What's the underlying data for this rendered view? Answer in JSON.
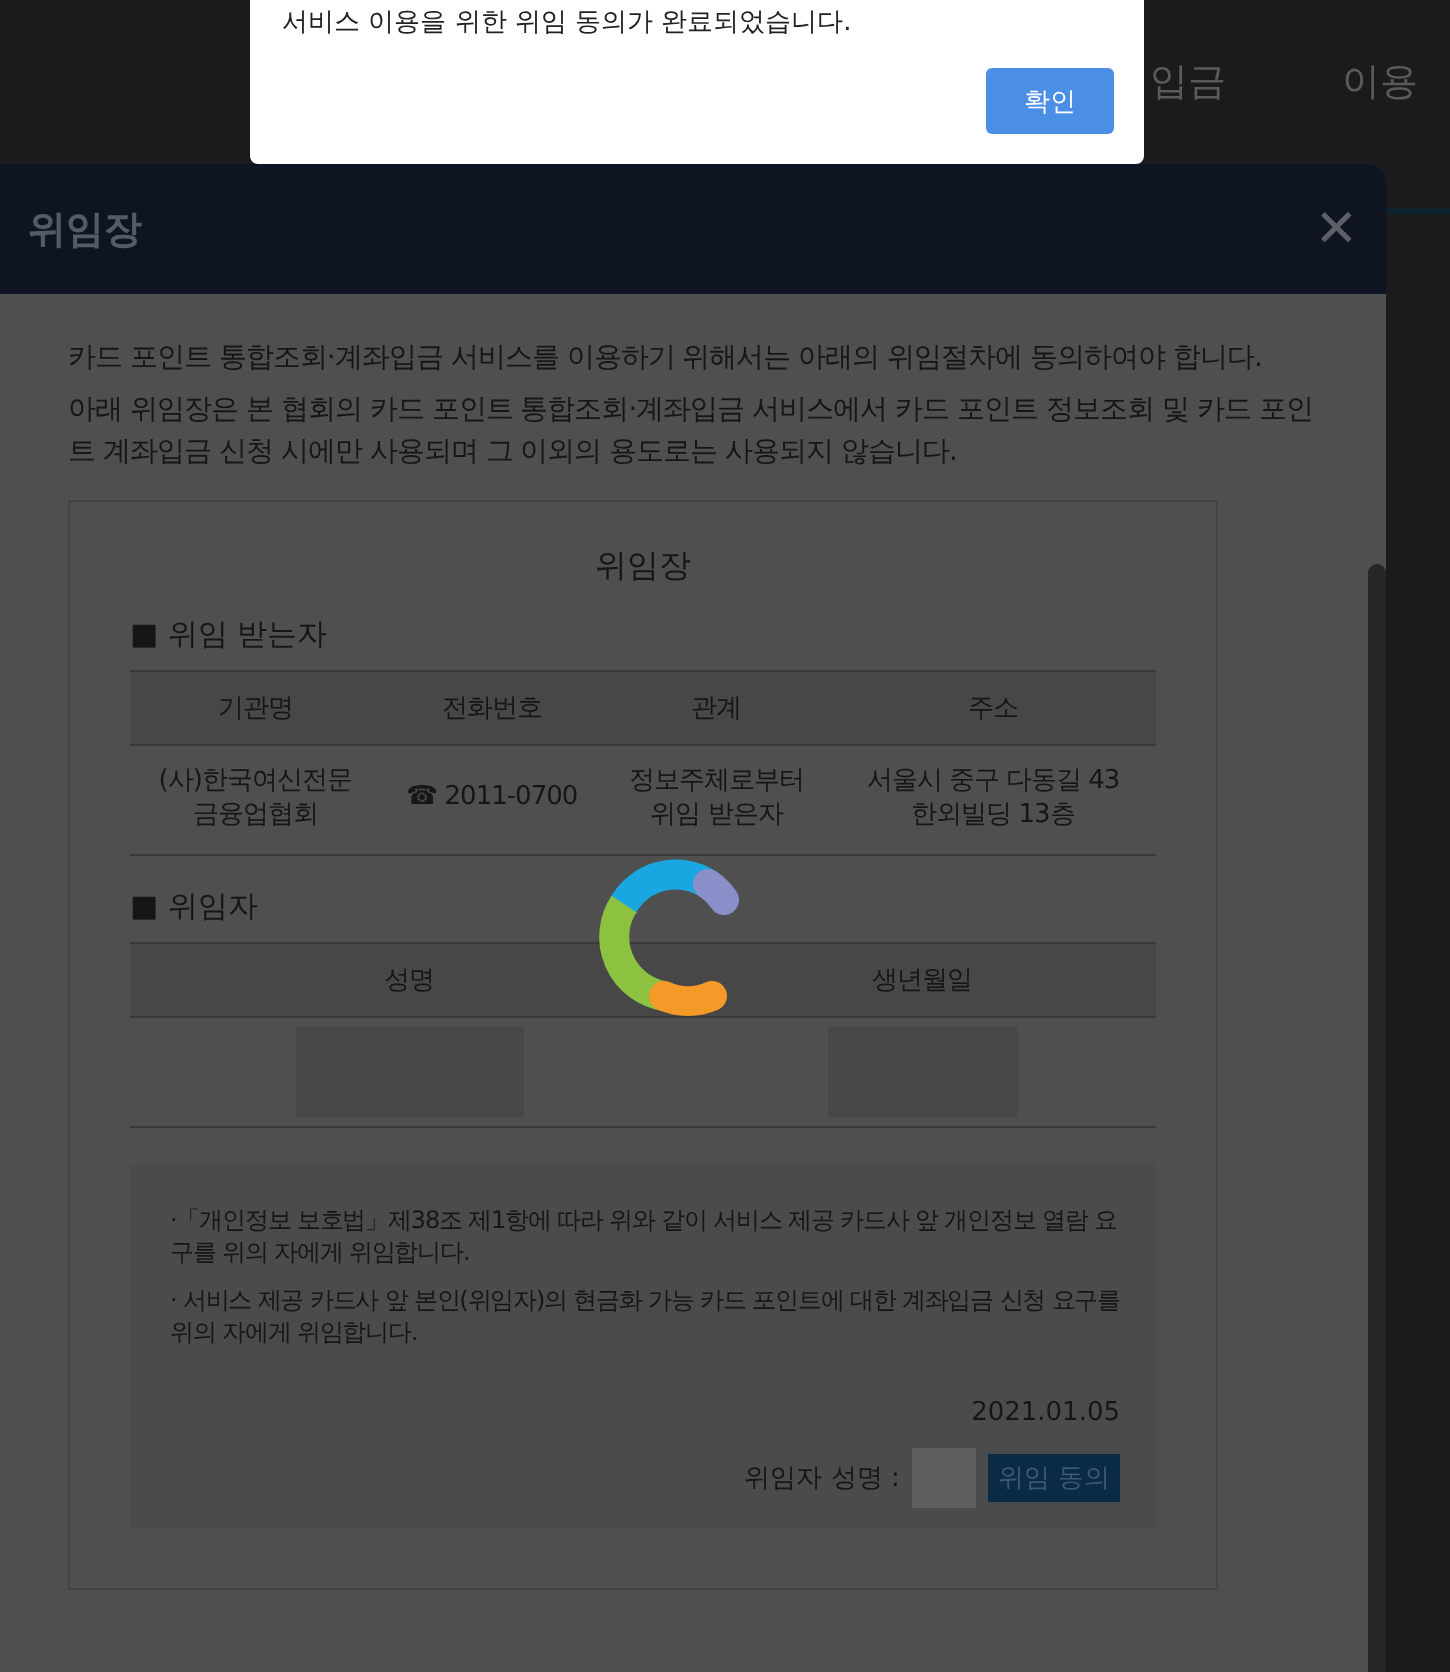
{
  "background_nav": [
    "입금",
    "이용"
  ],
  "alert": {
    "message": "서비스 이용을 위한 위임 동의가 완료되었습니다.",
    "button": "확인"
  },
  "modal": {
    "title": "위임장",
    "close": "✕",
    "intro": [
      "카드 포인트 통합조회·계좌입금 서비스를 이용하기 위해서는 아래의 위임절차에 동의하여야 합니다.",
      "아래 위임장은 본 협회의 카드 포인트 통합조회·계좌입금 서비스에서 카드 포인트 정보조회 및 카드 포인트 계좌입금 신청 시에만 사용되며 그 이외의 용도로는 사용되지 않습니다."
    ],
    "document": {
      "title": "위임장",
      "recipient": {
        "heading": "■ 위임 받는자",
        "columns": [
          "기관명",
          "전화번호",
          "관계",
          "주소"
        ],
        "row": [
          "(사)한국여신전문\n금융업협회",
          "☎ 2011-0700",
          "정보주체로부터\n위임 받은자",
          "서울시 중구 다동길 43\n한외빌딩 13층"
        ]
      },
      "delegator": {
        "heading": "■ 위임자",
        "columns": [
          "성명",
          "생년월일"
        ]
      },
      "notes": [
        "·「개인정보 보호법」제38조 제1항에 따라 위와 같이 서비스 제공 카드사 앞 개인정보 열람 요구를 위의 자에게 위임합니다.",
        "· 서비스 제공 카드사 앞 본인(위임자)의 현금화 가능 카드 포인트에 대한 계좌입금 신청 요구를 위의 자에게 위임합니다."
      ],
      "date": "2021.01.05",
      "signer_label": "위임자 성명 :",
      "agree_button": "위임 동의"
    }
  }
}
